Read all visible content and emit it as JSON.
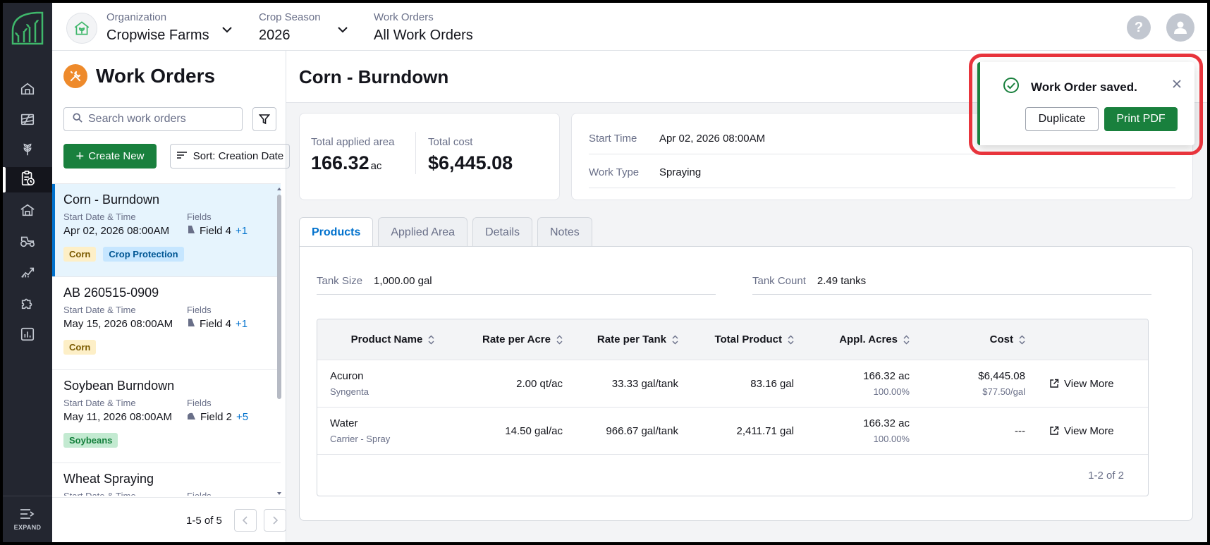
{
  "topbar": {
    "organization_label": "Organization",
    "organization_value": "Cropwise Farms",
    "season_label": "Crop Season",
    "season_value": "2026",
    "work_orders_label": "Work Orders",
    "work_orders_value": "All Work Orders",
    "help_glyph": "?"
  },
  "sidebar": {
    "items": [
      "home-icon",
      "fields-icon",
      "crops-icon",
      "work-orders-icon",
      "storage-icon",
      "equipment-icon",
      "analytics-icon",
      "integrations-icon",
      "reports-icon"
    ],
    "expand_label": "EXPAND"
  },
  "list_panel": {
    "title": "Work Orders",
    "search_placeholder": "Search work orders",
    "create_label": "Create New",
    "sort_label": "Sort: Creation Date",
    "start_label": "Start Date & Time",
    "fields_label": "Fields",
    "items": [
      {
        "name": "Corn - Burndown",
        "start": "Apr 02, 2026 08:00AM",
        "field": "Field 4",
        "more": "+1",
        "tags": [
          "Corn",
          "Crop Protection"
        ]
      },
      {
        "name": "AB 260515-0909",
        "start": "May 15, 2026 08:00AM",
        "field": "Field 4",
        "more": "+1",
        "tags": [
          "Corn"
        ]
      },
      {
        "name": "Soybean Burndown",
        "start": "May 11, 2026 08:00AM",
        "field": "Field 2",
        "more": "+5",
        "tags": [
          "Soybeans"
        ]
      },
      {
        "name": "Wheat Spraying",
        "start": "",
        "field": "",
        "more": "",
        "tags": []
      }
    ],
    "pagination": "1-5 of 5"
  },
  "main": {
    "title": "Corn - Burndown",
    "total_area_label": "Total applied area",
    "total_area_value": "166.32",
    "total_area_unit": "ac",
    "total_cost_label": "Total cost",
    "total_cost_value": "$6,445.08",
    "start_time_label": "Start Time",
    "start_time_value": "Apr 02, 2026 08:00AM",
    "work_type_label": "Work Type",
    "work_type_value": "Spraying",
    "tabs": [
      "Products",
      "Applied Area",
      "Details",
      "Notes"
    ],
    "tank_size_label": "Tank Size",
    "tank_size_value": "1,000.00 gal",
    "tank_count_label": "Tank Count",
    "tank_count_value": "2.49 tanks",
    "columns": [
      "Product Name",
      "Rate per Acre",
      "Rate per Tank",
      "Total Product",
      "Appl. Acres",
      "Cost"
    ],
    "rows": [
      {
        "name": "Acuron",
        "sub": "Syngenta",
        "rate_acre": "2.00 qt/ac",
        "rate_tank": "33.33 gal/tank",
        "total": "83.16 gal",
        "acres": "166.32 ac",
        "acres_pct": "100.00%",
        "cost": "$6,445.08",
        "cost_sub": "$77.50/gal",
        "action": "View More"
      },
      {
        "name": "Water",
        "sub": "Carrier - Spray",
        "rate_acre": "14.50 gal/ac",
        "rate_tank": "966.67 gal/tank",
        "total": "2,411.71 gal",
        "acres": "166.32 ac",
        "acres_pct": "100.00%",
        "cost": "---",
        "cost_sub": "",
        "action": "View More"
      }
    ],
    "table_pagination": "1-2 of 2"
  },
  "toast": {
    "message": "Work Order saved.",
    "duplicate_label": "Duplicate",
    "print_label": "Print PDF"
  },
  "colors": {
    "primary_green": "#19803d",
    "accent_blue": "#0071cd",
    "highlight_red": "#e8343c",
    "sidebar_bg": "#232630",
    "brand_orange": "#ee8a2b"
  }
}
